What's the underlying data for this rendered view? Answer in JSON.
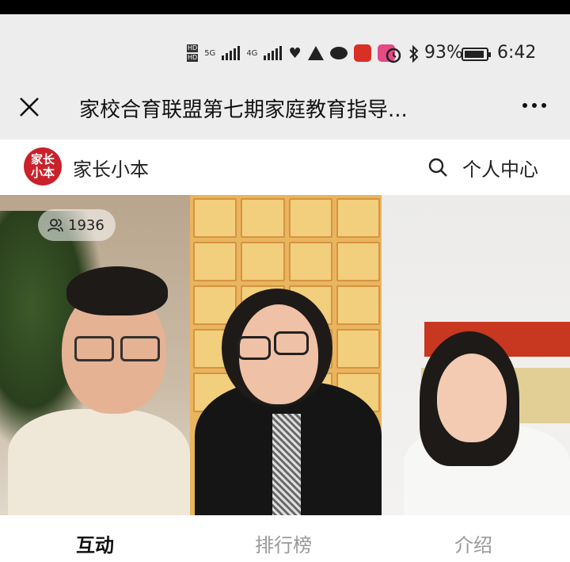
{
  "status_bar": {
    "hd1": "HD",
    "hd2": "HD",
    "net1": "5G",
    "net2": "4G",
    "battery_level": 0.93,
    "battery_text": "93%",
    "time": "6:42",
    "icons": [
      "heart-pulse-icon",
      "drive-icon",
      "wechat-icon",
      "red-app-icon",
      "bilibili-icon",
      "alarm-icon",
      "bluetooth-icon"
    ]
  },
  "nav": {
    "title": "家校合育联盟第七期家庭教育指导..."
  },
  "channel": {
    "logo_text": "家长小本",
    "name": "家长小本",
    "center_label": "个人中心"
  },
  "video": {
    "viewers": "1936"
  },
  "tabs": [
    {
      "label": "互动",
      "active": true
    },
    {
      "label": "排行榜",
      "active": false
    },
    {
      "label": "介绍",
      "active": false
    }
  ],
  "colors": {
    "logo_red": "#c9222b",
    "background": "#ededed"
  }
}
